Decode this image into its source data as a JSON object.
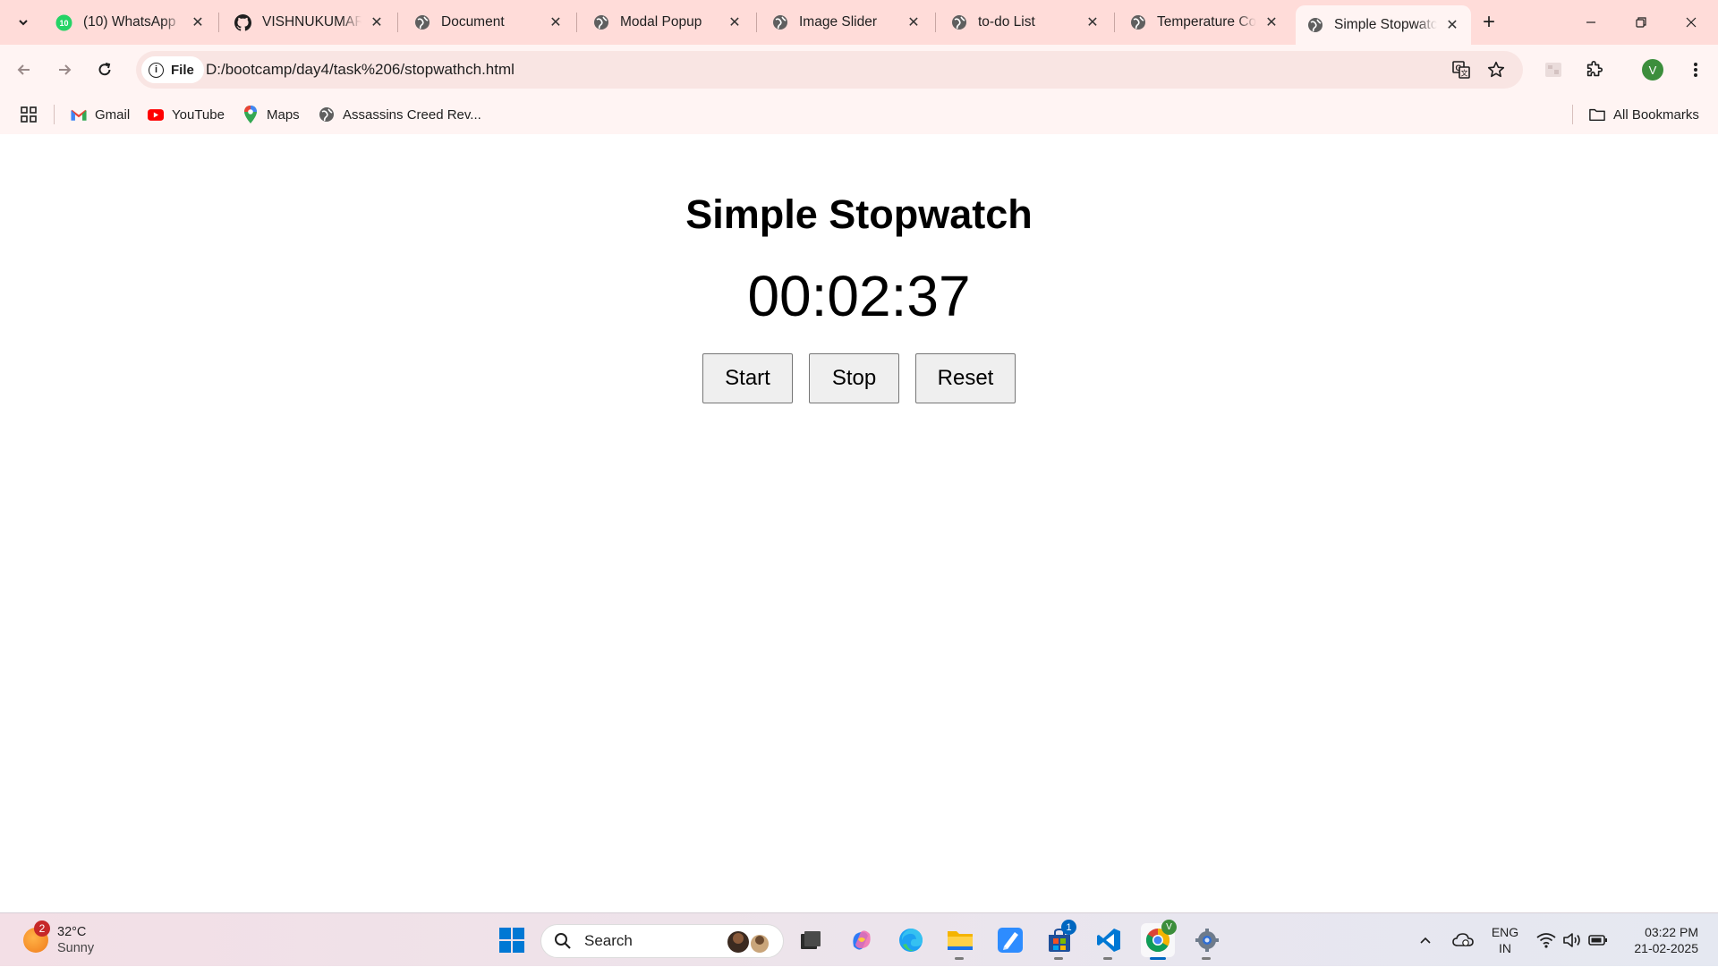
{
  "browser": {
    "tabs": [
      {
        "title": "(10) WhatsApp",
        "icon": "whatsapp-icon",
        "active": false
      },
      {
        "title": "VISHNUKUMAR2",
        "icon": "github-icon",
        "active": false
      },
      {
        "title": "Document",
        "icon": "globe-icon",
        "active": false
      },
      {
        "title": "Modal Popup",
        "icon": "globe-icon",
        "active": false
      },
      {
        "title": "Image Slider",
        "icon": "globe-icon",
        "active": false
      },
      {
        "title": "to-do List",
        "icon": "globe-icon",
        "active": false
      },
      {
        "title": "Temperature Co",
        "icon": "globe-icon",
        "active": false
      },
      {
        "title": "Simple Stopwatc",
        "icon": "globe-icon",
        "active": true
      }
    ],
    "whatsapp_badge": "10",
    "site_chip": "File",
    "url": "D:/bootcamp/day4/task%206/stopwathch.html",
    "profile_initial": "V",
    "bookmarks": [
      {
        "label": "Gmail",
        "icon": "gmail-icon"
      },
      {
        "label": "YouTube",
        "icon": "youtube-icon"
      },
      {
        "label": "Maps",
        "icon": "maps-icon"
      },
      {
        "label": "Assassins Creed Rev...",
        "icon": "globe-icon"
      }
    ],
    "all_bookmarks": "All Bookmarks"
  },
  "page": {
    "title": "Simple Stopwatch",
    "time": "00:02:37",
    "buttons": {
      "start": "Start",
      "stop": "Stop",
      "reset": "Reset"
    }
  },
  "taskbar": {
    "weather": {
      "temp": "32°C",
      "condition": "Sunny",
      "badge": "2"
    },
    "search_placeholder": "Search",
    "store_badge": "1",
    "chrome_badge": "V",
    "language": {
      "line1": "ENG",
      "line2": "IN"
    },
    "time": "03:22 PM",
    "date": "21-02-2025"
  },
  "colors": {
    "tabstrip_bg": "#ffdcd9",
    "toolbar_bg": "#fff4f3",
    "button_bg": "#efefef",
    "accent_blue": "#0067c0"
  }
}
